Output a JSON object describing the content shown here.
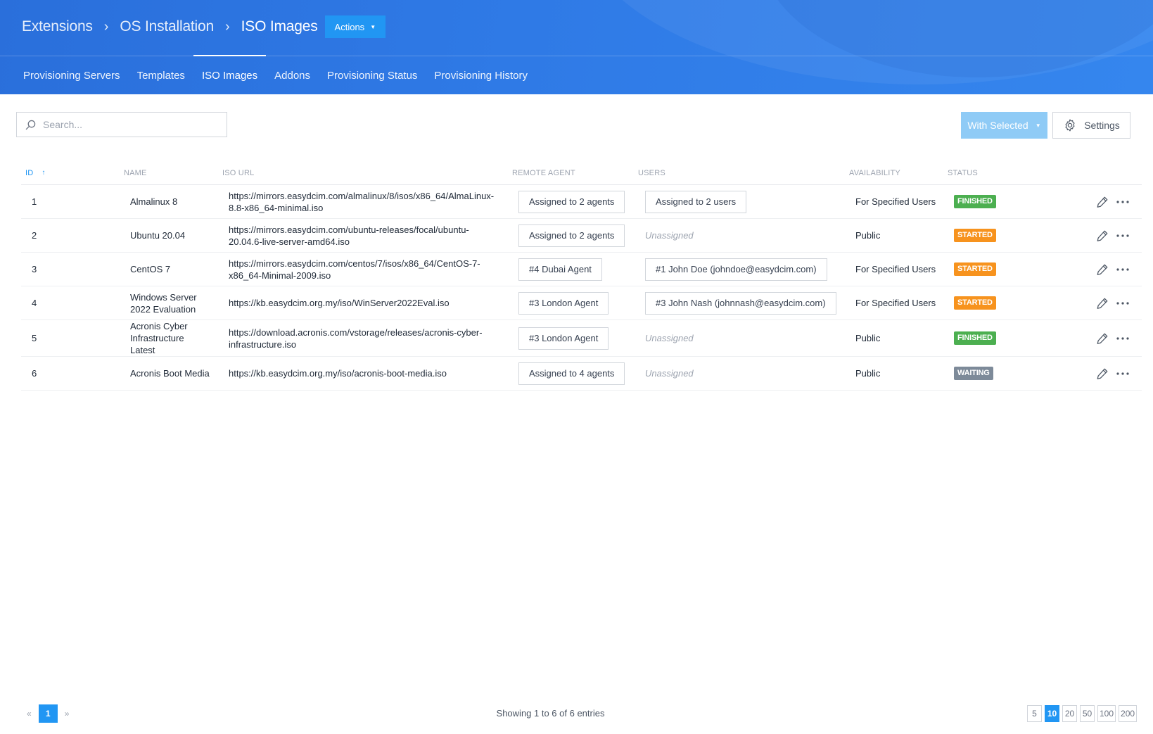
{
  "breadcrumb": {
    "items": [
      "Extensions",
      "OS Installation",
      "ISO Images"
    ],
    "actions_label": "Actions"
  },
  "tabs": [
    "Provisioning Servers",
    "Templates",
    "ISO Images",
    "Addons",
    "Provisioning Status",
    "Provisioning History"
  ],
  "active_tab": "ISO Images",
  "toolbar": {
    "search_placeholder": "Search...",
    "with_selected_label": "With Selected",
    "settings_label": "Settings"
  },
  "table": {
    "columns": {
      "id": "ID",
      "name": "NAME",
      "iso_url": "ISO URL",
      "remote_agent": "REMOTE AGENT",
      "users": "USERS",
      "availability": "AVAILABILITY",
      "status": "STATUS"
    },
    "rows": [
      {
        "id": "1",
        "name_lines": [
          "Almalinux 8"
        ],
        "url_lines": [
          "https://mirrors.easydcim.com/almalinux/8/isos/x86_64/AlmaLinux-",
          "8.8-x86_64-minimal.iso"
        ],
        "agent": "Assigned to 2 agents",
        "users": "Assigned to 2 users",
        "users_assigned": true,
        "availability": "For Specified Users",
        "status": "FINISHED"
      },
      {
        "id": "2",
        "name_lines": [
          "Ubuntu 20.04"
        ],
        "url_lines": [
          "https://mirrors.easydcim.com/ubuntu-releases/focal/ubuntu-",
          "20.04.6-live-server-amd64.iso"
        ],
        "agent": "Assigned to 2 agents",
        "users": "Unassigned",
        "users_assigned": false,
        "availability": "Public",
        "status": "STARTED"
      },
      {
        "id": "3",
        "name_lines": [
          "CentOS 7"
        ],
        "url_lines": [
          "https://mirrors.easydcim.com/centos/7/isos/x86_64/CentOS-7-",
          "x86_64-Minimal-2009.iso"
        ],
        "agent": "#4 Dubai Agent",
        "users": "#1 John Doe (johndoe@easydcim.com)",
        "users_assigned": true,
        "availability": "For Specified Users",
        "status": "STARTED"
      },
      {
        "id": "4",
        "name_lines": [
          "Windows Server",
          "2022 Evaluation"
        ],
        "url_lines": [
          "https://kb.easydcim.org.my/iso/WinServer2022Eval.iso"
        ],
        "agent": "#3 London Agent",
        "users": "#3 John Nash (johnnash@easydcim.com)",
        "users_assigned": true,
        "availability": "For Specified Users",
        "status": "STARTED"
      },
      {
        "id": "5",
        "name_lines": [
          "Acronis Cyber",
          "Infrastructure",
          "Latest"
        ],
        "url_lines": [
          "https://download.acronis.com/vstorage/releases/acronis-cyber-",
          "infrastructure.iso"
        ],
        "agent": "#3 London Agent",
        "users": "Unassigned",
        "users_assigned": false,
        "availability": "Public",
        "status": "FINISHED"
      },
      {
        "id": "6",
        "name_lines": [
          "Acronis Boot Media"
        ],
        "url_lines": [
          "https://kb.easydcim.org.my/iso/acronis-boot-media.iso"
        ],
        "agent": "Assigned to 4 agents",
        "users": "Unassigned",
        "users_assigned": false,
        "availability": "Public",
        "status": "WAITING"
      }
    ]
  },
  "status_colors": {
    "FINISHED": "#4caf50",
    "STARTED": "#f7931e",
    "WAITING": "#7d8a99"
  },
  "row_icons": [
    "pencil-icon",
    "more-horizontal-icon"
  ],
  "footer": {
    "current_page": "1",
    "entries_info": "Showing 1 to 6 of 6 entries",
    "page_sizes": [
      "5",
      "10",
      "20",
      "50",
      "100",
      "200"
    ],
    "active_page_size": "10"
  },
  "colors": {
    "header_blue": "#2f7ae6",
    "accent": "#2196f3",
    "with_selected_disabled": "#8fcbf6"
  }
}
